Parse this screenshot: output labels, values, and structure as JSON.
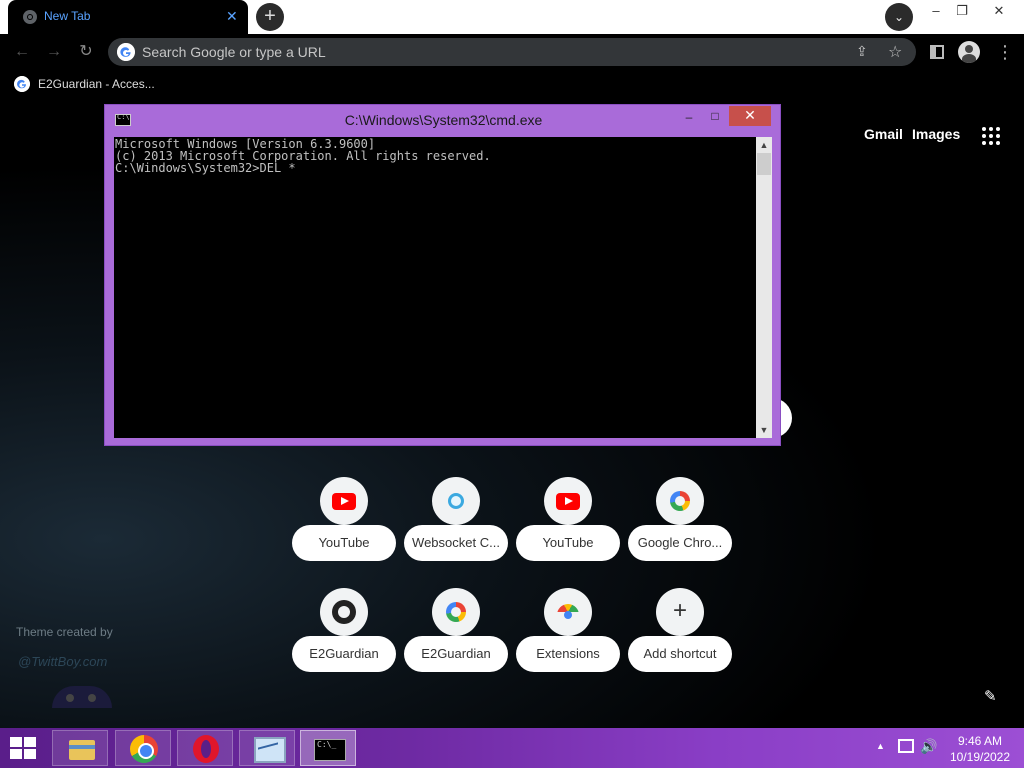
{
  "browser": {
    "tab": {
      "title": "New Tab",
      "close_glyph": "✕"
    },
    "new_tab_glyph": "+",
    "tab_search_glyph": "⌄",
    "window_controls": {
      "minimize": "–",
      "restore": "❐",
      "close": "✕"
    },
    "nav": {
      "back": "←",
      "forward": "→",
      "reload": "↻"
    },
    "omnibox": {
      "placeholder": "Search Google or type a URL"
    },
    "share_glyph": "⇪",
    "star_glyph": "☆",
    "menu_glyph": "⋮",
    "bookmarks": [
      {
        "label": "E2Guardian - Acces..."
      }
    ]
  },
  "ntp": {
    "links": {
      "gmail": "Gmail",
      "images": "Images"
    },
    "theme_credit": "Theme created by",
    "theme_handle": "@TwittBoy.com",
    "edit_glyph": "✎",
    "shortcuts": [
      {
        "label": "YouTube",
        "icon": "youtube-icon"
      },
      {
        "label": "Websocket C...",
        "icon": "websocket-icon"
      },
      {
        "label": "YouTube",
        "icon": "youtube-icon"
      },
      {
        "label": "Google Chro...",
        "icon": "google-icon"
      },
      {
        "label": "E2Guardian",
        "icon": "github-icon"
      },
      {
        "label": "E2Guardian",
        "icon": "google-icon"
      },
      {
        "label": "Extensions",
        "icon": "chrome-web-store-icon"
      },
      {
        "label": "Add shortcut",
        "icon": "add-icon"
      }
    ],
    "add_glyph": "+"
  },
  "cmd": {
    "title": "C:\\Windows\\System32\\cmd.exe",
    "minimize_glyph": "–",
    "maximize_glyph": "□",
    "close_glyph": "✕",
    "lines": [
      "Microsoft Windows [Version 6.3.9600]",
      "(c) 2013 Microsoft Corporation. All rights reserved.",
      "C:\\Windows\\System32>DEL *"
    ],
    "scroll_up_glyph": "▲",
    "scroll_down_glyph": "▼"
  },
  "taskbar": {
    "apps": [
      "file-explorer",
      "chrome",
      "opera",
      "performance-monitor",
      "command-prompt"
    ],
    "tray_up_glyph": "▲",
    "volume_glyph": "🔊",
    "time": "9:46 AM",
    "date": "10/19/2022"
  },
  "colors": {
    "accent_tab_text": "#5aa3ff",
    "cmd_frame": "#a96bd9",
    "cmd_close": "#c7504b",
    "taskbar": "#6e2aa3"
  }
}
